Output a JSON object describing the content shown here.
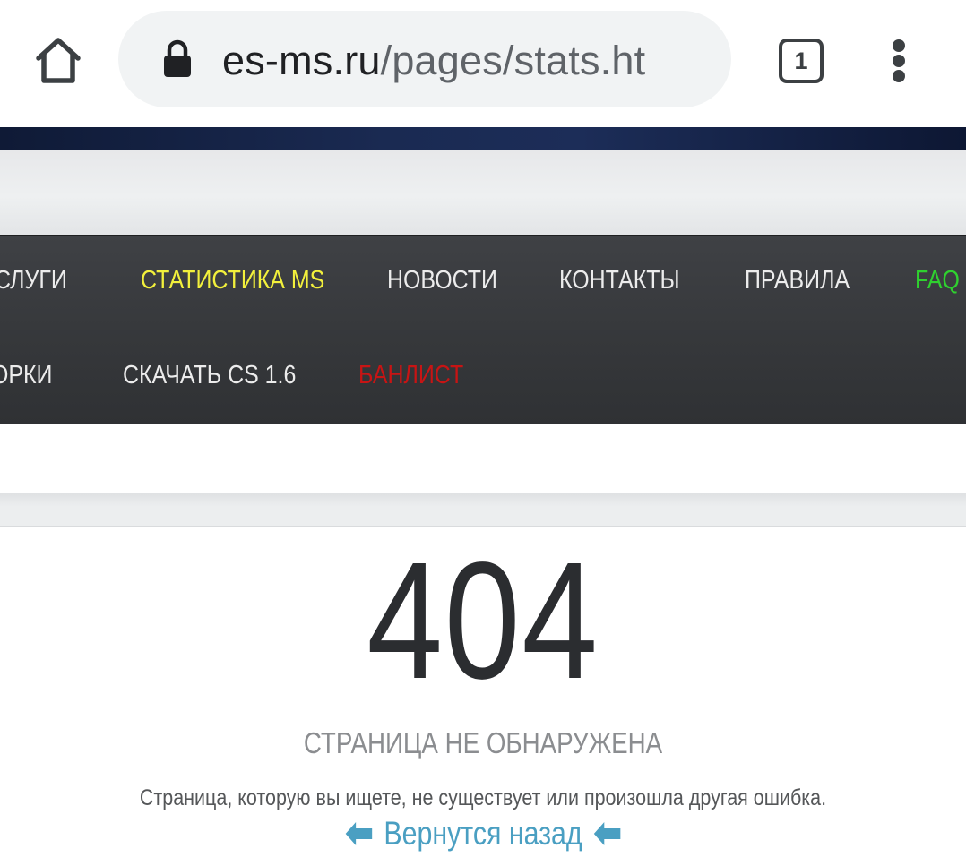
{
  "browser": {
    "url_domain": "es-ms.ru",
    "url_path": "/pages/stats.ht",
    "tab_count": "1",
    "icons": {
      "home": "home-icon",
      "lock": "lock-icon",
      "tabs": "tab-switcher-icon",
      "menu": "more-vert-icon"
    }
  },
  "nav": {
    "row1": [
      {
        "label": "СЛУГИ",
        "color": "#ececec"
      },
      {
        "label": "СТАТИСТИКА MS",
        "color": "#f2f03c"
      },
      {
        "label": "НОВОСТИ",
        "color": "#ececec"
      },
      {
        "label": "КОНТАКТЫ",
        "color": "#ececec"
      },
      {
        "label": "ПРАВИЛА",
        "color": "#ececec"
      },
      {
        "label": "FAQ",
        "color": "#2fd12f"
      }
    ],
    "row2": [
      {
        "label": "ОРКИ",
        "color": "#ececec"
      },
      {
        "label": "СКАЧАТЬ CS 1.6",
        "color": "#ececec"
      },
      {
        "label": "БАНЛИСТ",
        "color": "#c81414"
      }
    ]
  },
  "error": {
    "code": "404",
    "title": "СТРАНИЦА НЕ ОБНАРУЖЕНА",
    "description": "Страница, которую вы ищете, не существует или произошла другая ошибка.",
    "back_label": "Вернутся назад",
    "back_icon": "arrow-left-icon",
    "link_color": "#4a9fc2"
  }
}
